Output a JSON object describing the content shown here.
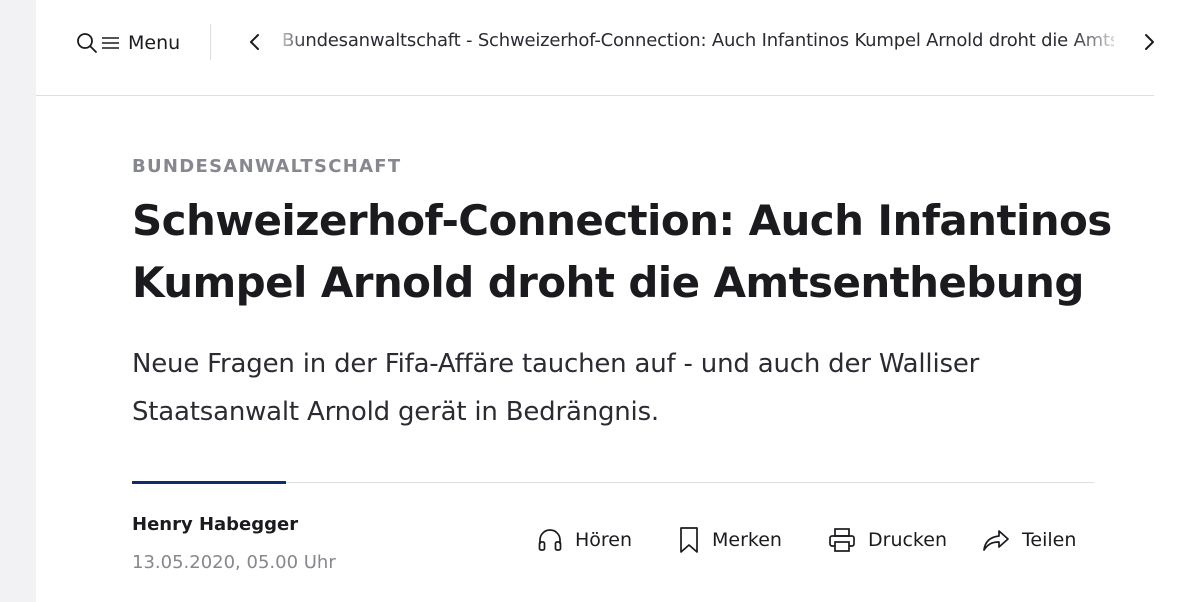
{
  "nav": {
    "menu_label": "Menu",
    "search_icon": "search-icon",
    "menu_icon": "hamburger-icon",
    "prev_icon": "chevron-left-icon",
    "next_icon": "chevron-right-icon",
    "ticker_text": "Bundesanwaltschaft - Schweizerhof-Connection: Auch Infantinos Kumpel Arnold droht die Amtsenthebung"
  },
  "article": {
    "kicker": "BUNDESANWALTSCHAFT",
    "headline": "Schweizerhof-Connection: Auch Infantinos Kumpel Arnold droht die Amtsenthebung",
    "lead": "Neue Fragen in der Fifa-Affäre tauchen auf - und auch der Walliser Staatsanwalt Arnold gerät in Bedrängnis.",
    "author": "Henry Habegger",
    "date": "13.05.2020, 05.00 Uhr"
  },
  "actions": [
    {
      "label": "Hören",
      "icon": "headphones-icon"
    },
    {
      "label": "Merken",
      "icon": "bookmark-icon"
    },
    {
      "label": "Drucken",
      "icon": "printer-icon"
    },
    {
      "label": "Teilen",
      "icon": "share-icon"
    }
  ],
  "colors": {
    "accent": "#0f2c6e",
    "kicker": "#86878f",
    "text": "#1b1b1f",
    "background": "#ffffff"
  }
}
